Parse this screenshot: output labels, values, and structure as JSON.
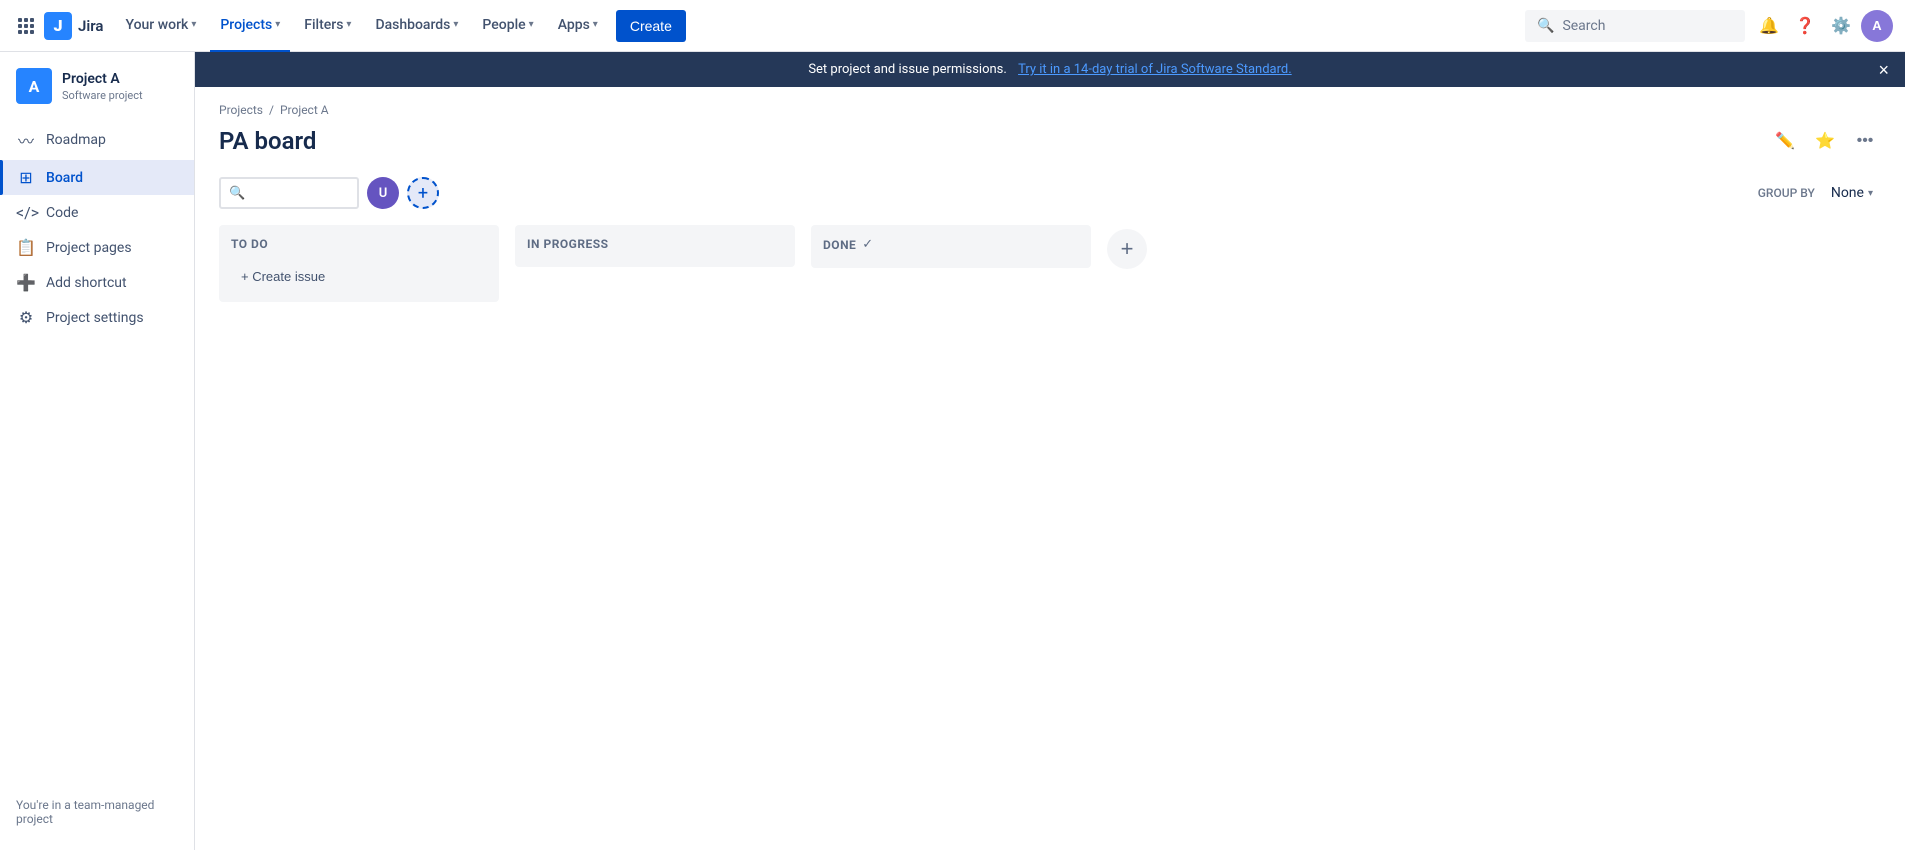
{
  "topnav": {
    "logo_text": "Jira",
    "your_work_label": "Your work",
    "projects_label": "Projects",
    "filters_label": "Filters",
    "dashboards_label": "Dashboards",
    "people_label": "People",
    "apps_label": "Apps",
    "create_label": "Create",
    "search_placeholder": "Search"
  },
  "banner": {
    "text": "Set project and issue permissions.",
    "link_text": "Try it in a 14-day trial of Jira Software Standard."
  },
  "sidebar": {
    "project_name": "Project A",
    "project_type": "Software project",
    "nav_items": [
      {
        "id": "roadmap",
        "label": "Roadmap",
        "icon": "⋯"
      },
      {
        "id": "board",
        "label": "Board",
        "icon": "▦",
        "active": true
      },
      {
        "id": "code",
        "label": "Code",
        "icon": "</>"
      },
      {
        "id": "project-pages",
        "label": "Project pages",
        "icon": "📄"
      },
      {
        "id": "add-shortcut",
        "label": "Add shortcut",
        "icon": "+"
      },
      {
        "id": "project-settings",
        "label": "Project settings",
        "icon": "⚙"
      }
    ],
    "footer_text": "You're in a team-managed project"
  },
  "board": {
    "breadcrumb": {
      "projects_label": "Projects",
      "project_label": "Project A"
    },
    "title": "PA board",
    "group_by_label": "GROUP BY",
    "group_by_value": "None",
    "columns": [
      {
        "id": "todo",
        "title": "TO DO",
        "check": false
      },
      {
        "id": "in-progress",
        "title": "IN PROGRESS",
        "check": false
      },
      {
        "id": "done",
        "title": "DONE",
        "check": true
      }
    ],
    "create_issue_label": "+ Create issue",
    "add_column_label": "+"
  }
}
